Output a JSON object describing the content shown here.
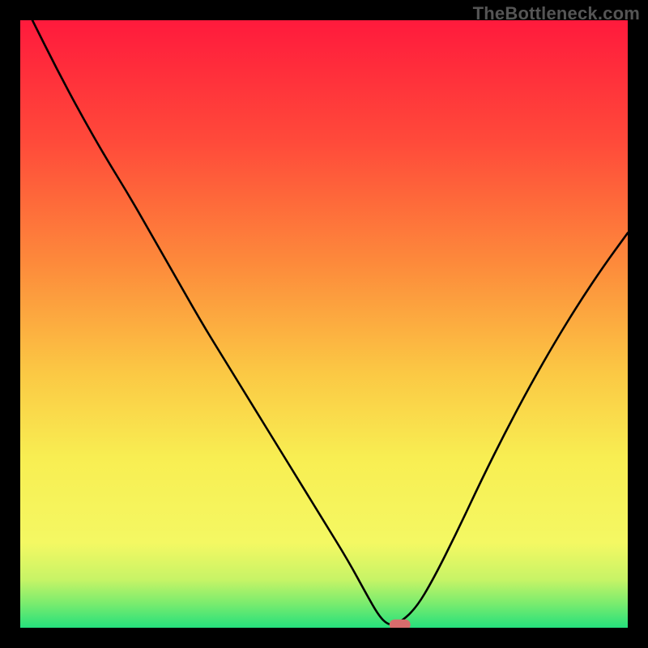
{
  "watermark": "TheBottleneck.com",
  "chart_data": {
    "type": "line",
    "title": "",
    "xlabel": "",
    "ylabel": "",
    "xlim": [
      0,
      100
    ],
    "ylim": [
      0,
      100
    ],
    "grid": false,
    "legend": false,
    "series": [
      {
        "name": "curve",
        "x": [
          2,
          6,
          10,
          14,
          18,
          22,
          26,
          30,
          34,
          38,
          42,
          46,
          50,
          54,
          57,
          59,
          60.5,
          62,
          65,
          68,
          72,
          76,
          80,
          84,
          88,
          92,
          96,
          100
        ],
        "y": [
          100,
          92,
          84.5,
          77.5,
          71,
          64,
          57,
          50,
          43.5,
          37,
          30.5,
          24,
          17.5,
          11,
          5.5,
          2,
          0.5,
          0.5,
          3,
          8,
          16,
          24.5,
          32.5,
          40,
          47,
          53.5,
          59.5,
          65
        ]
      }
    ],
    "marker": {
      "x": 62.5,
      "y": 0.5,
      "color": "#d86d6d"
    },
    "bands": [
      {
        "y0": 0,
        "y1": 3,
        "color": "#2FE37A"
      },
      {
        "y0": 3,
        "y1": 5,
        "color": "#8FEE6B"
      },
      {
        "y0": 5,
        "y1": 11,
        "color": "#F2F76A"
      },
      {
        "y0": 11,
        "y1": 17,
        "color": "#F7F560"
      }
    ],
    "gradient_stops": [
      {
        "offset": 0,
        "color": "#FF1A3C"
      },
      {
        "offset": 20,
        "color": "#FF4A3A"
      },
      {
        "offset": 40,
        "color": "#FD8A3B"
      },
      {
        "offset": 58,
        "color": "#FBC844"
      },
      {
        "offset": 72,
        "color": "#F8EE52"
      },
      {
        "offset": 86,
        "color": "#F4F863"
      },
      {
        "offset": 92,
        "color": "#C8F466"
      },
      {
        "offset": 96,
        "color": "#7AEC6E"
      },
      {
        "offset": 100,
        "color": "#25E07C"
      }
    ]
  }
}
